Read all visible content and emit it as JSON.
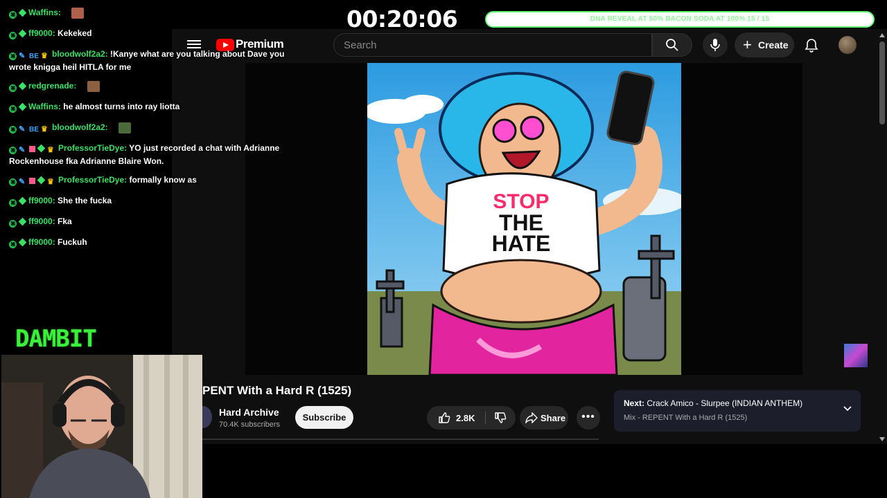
{
  "stream": {
    "timer": "00:20:06",
    "goal_text": "DNA REVEAL AT 50% BACON SODA AT 100% 15 / 15",
    "goal_progress": 1.0,
    "logo_text": "DAMBIT"
  },
  "chat": [
    {
      "user": "Waffins:",
      "badges": [
        "x",
        "dia"
      ],
      "text": "",
      "emote": true,
      "emote_color": "#b0604a"
    },
    {
      "user": "ff9000:",
      "badges": [
        "x",
        "dia"
      ],
      "text": "Kekeked"
    },
    {
      "user": "bloodwolf2a2:",
      "badges": [
        "x",
        "swd",
        "bot",
        "crown"
      ],
      "text": "!Kanye what are you talking about Dave you wrote knigga heil HITLA for me"
    },
    {
      "user": "redgrenade:",
      "badges": [
        "x",
        "dia"
      ],
      "text": "",
      "emote": true,
      "emote_color": "#8a6040"
    },
    {
      "user": "Waffins:",
      "badges": [
        "x",
        "dia"
      ],
      "text": "he almost turns into ray liotta"
    },
    {
      "user": "bloodwolf2a2:",
      "badges": [
        "x",
        "swd",
        "bot",
        "crown"
      ],
      "text": "",
      "emote": true,
      "emote_color": "#4a6a3a"
    },
    {
      "user": "ProfessorTieDye:",
      "badges": [
        "x",
        "swd",
        "gift",
        "dia",
        "crown"
      ],
      "text": "YO just recorded a chat with Adrianne Rockenhouse fka Adrianne Blaire Won."
    },
    {
      "user": "ProfessorTieDye:",
      "badges": [
        "x",
        "swd",
        "gift",
        "dia",
        "crown"
      ],
      "text": "formally know as"
    },
    {
      "user": "ff9000:",
      "badges": [
        "x",
        "dia"
      ],
      "text": "She the fucka"
    },
    {
      "user": "ff9000:",
      "badges": [
        "x",
        "dia"
      ],
      "text": "Fka"
    },
    {
      "user": "ff9000:",
      "badges": [
        "x",
        "dia"
      ],
      "text": "Fuckuh"
    }
  ],
  "youtube": {
    "logo_text": "Premium",
    "search_placeholder": "Search",
    "create_label": "Create",
    "video_title": "PENT With a Hard R (1525)",
    "channel_name": "Hard Archive",
    "subscriber_count": "70.4K subscribers",
    "subscribe_label": "Subscribe",
    "like_count": "2.8K",
    "share_label": "Share",
    "more_label": "•••",
    "next_prefix": "Next:",
    "next_title": "Crack Amico - Slurpee (INDIAN ANTHEM)",
    "next_sub": "Mix - REPENT With a Hard R (1525)",
    "artwork_shirt_text": [
      "STOP",
      "THE",
      "HATE"
    ]
  },
  "colors": {
    "chat_username": "#3be065",
    "goal_border": "#5dfd6f",
    "dambit_green": "#3bf03b",
    "yt_bg": "#0f0f0f",
    "yt_red": "#ff0000"
  }
}
